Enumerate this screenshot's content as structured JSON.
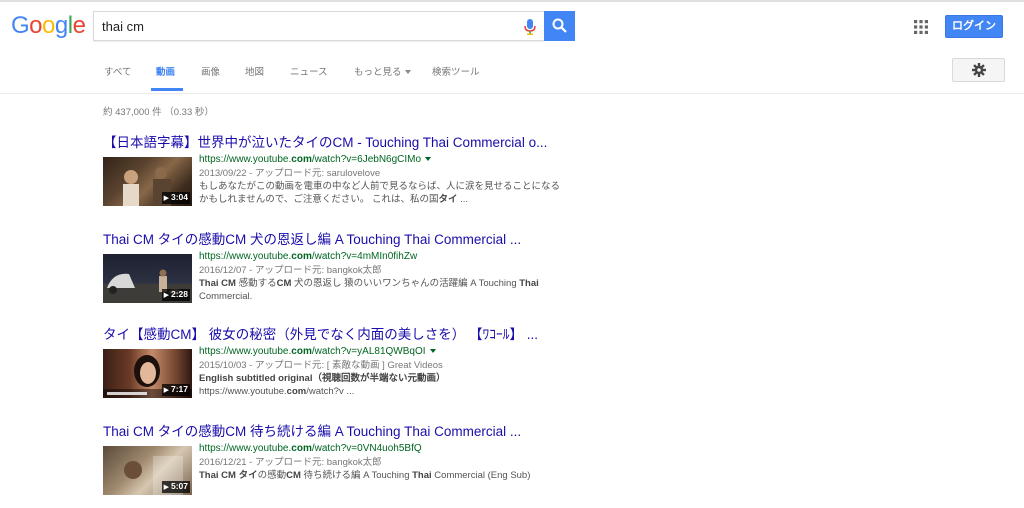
{
  "logo": {
    "letters": [
      "G",
      "o",
      "o",
      "g",
      "l",
      "e"
    ],
    "colors": [
      "#4285f4",
      "#ea4335",
      "#fbbc05",
      "#4285f4",
      "#34a853",
      "#ea4335"
    ]
  },
  "search": {
    "query": "thai cm"
  },
  "header": {
    "login_label": "ログイン"
  },
  "tabs": [
    {
      "label": "すべて"
    },
    {
      "label": "動画",
      "active": true
    },
    {
      "label": "画像"
    },
    {
      "label": "地図"
    },
    {
      "label": "ニュース"
    },
    {
      "label": "もっと見る"
    },
    {
      "label": "検索ツール"
    }
  ],
  "stats": "約 437,000 件 （0.33 秒）",
  "results": [
    {
      "title": "【日本語字幕】世界中が泣いたタイのCM - Touching Thai Commercial o...",
      "url": "https://www.youtube.com/watch?v=6JebN6gCIMo",
      "url_pre": "https://www.youtube.",
      "url_bold": "com",
      "url_post": "/watch?v=6JebN6gCIMo",
      "has_caret": true,
      "date": "2013/09/22 - アップロード元: sarulovelove",
      "snippet_1": "もしあなたがこの動画を電車の中など人前で見るならば、人に涙を見せることになるかもしれませんので、ご注意ください。 これは、私の国",
      "snippet_bold": "タイ",
      "snippet_2": " ...",
      "duration": "3:04"
    },
    {
      "title": "Thai CM タイの感動CM 犬の恩返し編 A Touching Thai Commercial ...",
      "url_pre": "https://www.youtube.",
      "url_bold": "com",
      "url_post": "/watch?v=4mMIn0fihZw",
      "has_caret": false,
      "date": "2016/12/07 - アップロード元: bangkok太郎",
      "snippet_html_parts": [
        "Thai CM",
        " 感動する",
        "CM",
        " 犬の恩返し 猿のいいワンちゃんの活躍編 A Touching ",
        "Thai",
        " Commercial."
      ],
      "duration": "2:28"
    },
    {
      "title": "タイ【感動CM】 彼女の秘密（外見でなく内面の美しさを） 【ﾜｺｰﾙ】 ...",
      "url_pre": "https://www.youtube.",
      "url_bold": "com",
      "url_post": "/watch?v=yAL81QWBqOI",
      "has_caret": true,
      "date": "2015/10/03 - アップロード元: [ 素敵な動画 ] Great Videos",
      "snippet_line1": "English subtitled original（視聴回数が半端ない元動画）",
      "snippet_line2_pre": "https://www.youtube.",
      "snippet_line2_bold": "com",
      "snippet_line2_post": "/watch?v ...",
      "duration": "7:17"
    },
    {
      "title": "Thai CM タイの感動CM 待ち続ける編 A Touching Thai Commercial ...",
      "url_pre": "https://www.youtube.",
      "url_bold": "com",
      "url_post": "/watch?v=0VN4uoh5BfQ",
      "has_caret": false,
      "date": "2016/12/21 - アップロード元: bangkok太郎",
      "snippet_html_parts": [
        "Thai CM タイ",
        "の感動",
        "CM",
        " 待ち続ける編 A Touching ",
        "Thai",
        " Commercial (Eng Sub)"
      ],
      "duration": "5:07"
    }
  ]
}
